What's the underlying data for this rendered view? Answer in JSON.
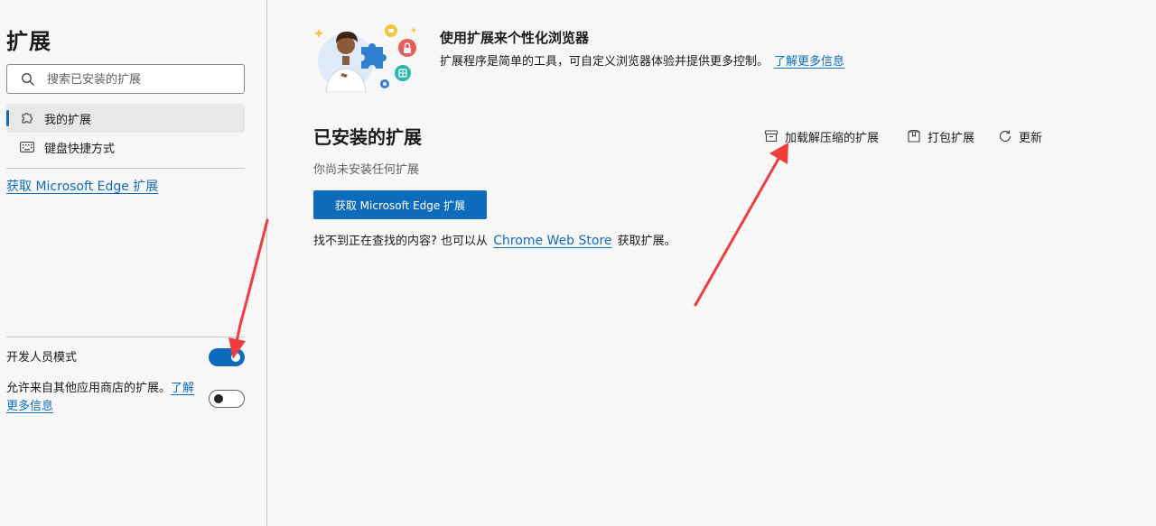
{
  "sidebar": {
    "title": "扩展",
    "search_placeholder": "搜索已安装的扩展",
    "items": [
      {
        "label": "我的扩展",
        "icon": "puzzle-icon",
        "active": true
      },
      {
        "label": "键盘快捷方式",
        "icon": "keyboard-icon",
        "active": false
      }
    ],
    "get_extensions_link": "获取 Microsoft Edge 扩展",
    "developer_mode": {
      "label": "开发人员模式",
      "enabled": true
    },
    "allow_other_stores": {
      "label": "允许来自其他应用商店的扩展。",
      "link": "了解更多信息",
      "enabled": false
    }
  },
  "banner": {
    "title": "使用扩展来个性化浏览器",
    "description": "扩展程序是简单的工具，可自定义浏览器体验并提供更多控制。",
    "link": "了解更多信息"
  },
  "main": {
    "title": "已安装的扩展",
    "actions": [
      {
        "label": "加载解压缩的扩展",
        "icon": "archive-box-icon"
      },
      {
        "label": "打包扩展",
        "icon": "package-icon"
      },
      {
        "label": "更新",
        "icon": "refresh-icon"
      }
    ],
    "empty_text": "你尚未安装任何扩展",
    "get_button": "获取 Microsoft Edge 扩展",
    "find_prefix": "找不到正在查找的内容? 也可以从",
    "find_link": "Chrome Web Store",
    "find_suffix": "获取扩展。"
  },
  "colors": {
    "accent": "#0f6cbd",
    "annotation_arrow": "#f03c3c"
  }
}
